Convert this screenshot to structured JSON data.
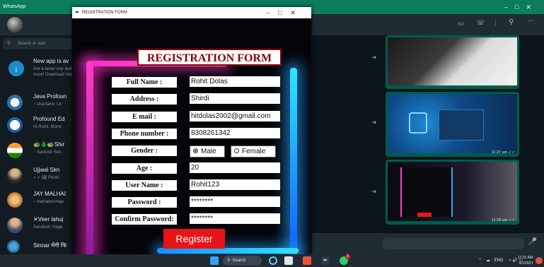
{
  "whatsapp": {
    "window_title": "WhatsApp",
    "search_placeholder": "Search or start",
    "chats": [
      {
        "title": "New app is av",
        "subtitle": "Get a faster exp and more! Download now"
      },
      {
        "title": "Java Profoun",
        "subtitle": "~ shantanu: Le"
      },
      {
        "title": "Profound Ed",
        "subtitle": "Hi Rohit. Mond"
      },
      {
        "title": "🐢🌲🐢Shir",
        "subtitle": "~ Santosh Son"
      },
      {
        "title": "Ujjwal Skn",
        "subtitle": "✓✓ 🖼 Photo"
      },
      {
        "title": "JAY MALHAI",
        "subtitle": "~ mahadevmaja"
      },
      {
        "title": "✕Veer lahuj",
        "subtitle": "Sandesh: Happ"
      },
      {
        "title": "Sinnar मेंगी फि",
        "subtitle": ""
      }
    ],
    "messages": [
      {
        "time": "11:27 am ✓✓"
      },
      {
        "time": "11:27 am ✓✓"
      },
      {
        "time": "11:28 am ✓✓"
      }
    ]
  },
  "registration": {
    "window_title": "REGISTRATION FORM",
    "form_title": "REGISTRATION FORM",
    "labels": {
      "full_name": "Full Name :",
      "address": "Address :",
      "email": "E mail :",
      "phone": "Phone number :",
      "gender": "Gender :",
      "age": "Age :",
      "username": "User Name :",
      "password": "Password :",
      "confirm_password": "Confirm Password:"
    },
    "values": {
      "full_name": "Rohit Dolas",
      "address": "Shirdi",
      "email": "hitdolas2002@gmail.com",
      "phone": "8308261342",
      "age": "20",
      "username": "Rohit123",
      "password": "********",
      "confirm_password": "********"
    },
    "gender_options": [
      "Male",
      "Female"
    ],
    "gender_selected": "Male",
    "register_label": "Register"
  },
  "taskbar": {
    "search_label": "Search",
    "language": "ENG",
    "clock_time": "11:31 AM",
    "clock_date": "4/1/2023",
    "badge_count": "3"
  }
}
